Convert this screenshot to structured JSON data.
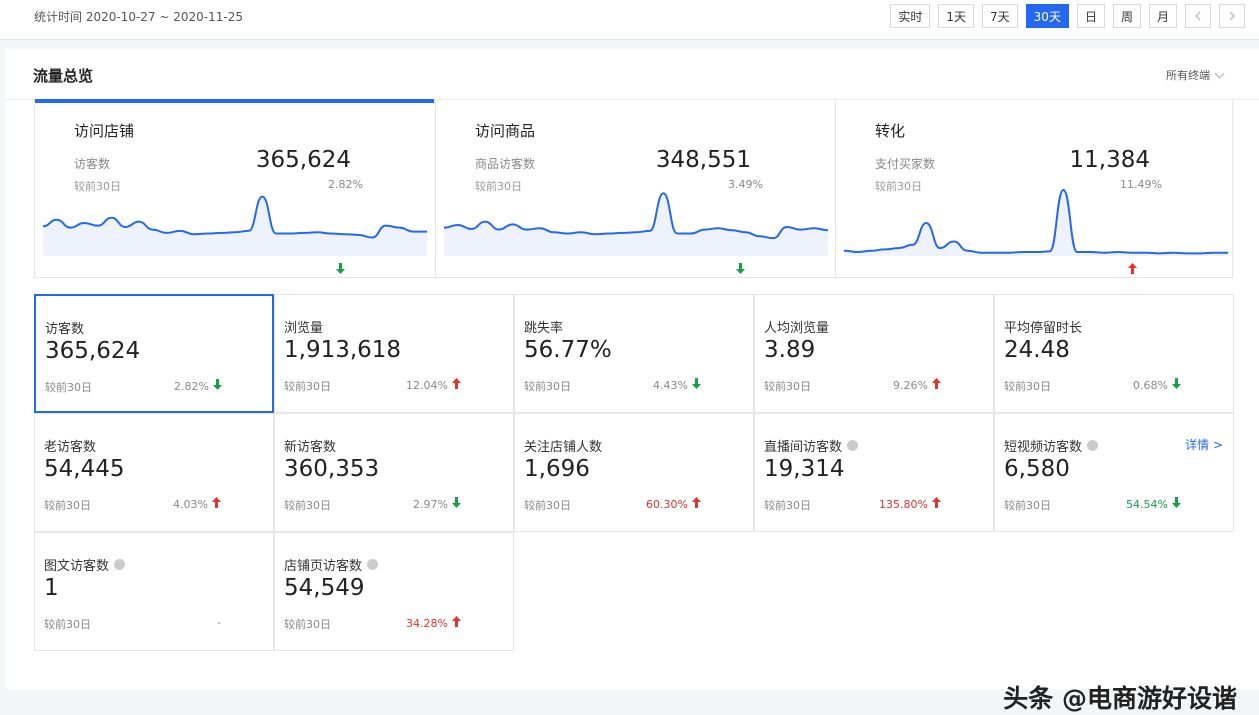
{
  "header": {
    "period": "统计时间 2020-10-27 ~ 2020-11-25",
    "ranges": [
      "实时",
      "1天",
      "7天",
      "30天",
      "日",
      "周",
      "月"
    ],
    "active_range": "30天"
  },
  "panel": {
    "title": "流量总览",
    "terminal_filter": "所有终端"
  },
  "cards": [
    {
      "title": "访问店铺",
      "label": "访客数",
      "value": "365,624",
      "compare": "较前30日",
      "pct": "2.82%",
      "trend": "down",
      "spark": [
        0.45,
        0.55,
        0.43,
        0.5,
        0.46,
        0.58,
        0.44,
        0.52,
        0.4,
        0.35,
        0.38,
        0.33,
        0.34,
        0.35,
        0.36,
        0.38,
        0.9,
        0.34,
        0.34,
        0.35,
        0.36,
        0.34,
        0.33,
        0.32,
        0.28,
        0.46,
        0.43,
        0.37,
        0.37
      ]
    },
    {
      "title": "访问商品",
      "label": "商品访客数",
      "value": "348,551",
      "compare": "较前30日",
      "pct": "3.49%",
      "trend": "down",
      "spark": [
        0.43,
        0.47,
        0.41,
        0.52,
        0.4,
        0.48,
        0.4,
        0.42,
        0.36,
        0.34,
        0.36,
        0.33,
        0.34,
        0.35,
        0.36,
        0.38,
        0.95,
        0.34,
        0.34,
        0.4,
        0.42,
        0.39,
        0.36,
        0.3,
        0.27,
        0.44,
        0.4,
        0.42,
        0.39
      ]
    },
    {
      "title": "转化",
      "label": "支付买家数",
      "value": "11,384",
      "compare": "较前30日",
      "pct": "11.49%",
      "trend": "up",
      "spark": [
        0.08,
        0.06,
        0.08,
        0.1,
        0.12,
        0.17,
        0.5,
        0.12,
        0.22,
        0.08,
        0.05,
        0.05,
        0.05,
        0.06,
        0.06,
        0.07,
        1.0,
        0.06,
        0.06,
        0.05,
        0.06,
        0.05,
        0.05,
        0.04,
        0.05,
        0.04,
        0.04,
        0.05,
        0.05
      ]
    }
  ],
  "metrics": [
    {
      "label": "访客数",
      "value": "365,624",
      "compare": "较前30日",
      "pct": "2.82%",
      "trend": "down",
      "selected": true,
      "info": false
    },
    {
      "label": "浏览量",
      "value": "1,913,618",
      "compare": "较前30日",
      "pct": "12.04%",
      "trend": "up",
      "info": false
    },
    {
      "label": "跳失率",
      "value": "56.77%",
      "compare": "较前30日",
      "pct": "4.43%",
      "trend": "down",
      "info": false
    },
    {
      "label": "人均浏览量",
      "value": "3.89",
      "compare": "较前30日",
      "pct": "9.26%",
      "trend": "up",
      "info": false
    },
    {
      "label": "平均停留时长",
      "value": "24.48",
      "compare": "较前30日",
      "pct": "0.68%",
      "trend": "down",
      "info": false
    },
    {
      "label": "老访客数",
      "value": "54,445",
      "compare": "较前30日",
      "pct": "4.03%",
      "trend": "up",
      "info": false
    },
    {
      "label": "新访客数",
      "value": "360,353",
      "compare": "较前30日",
      "pct": "2.97%",
      "trend": "down",
      "info": false
    },
    {
      "label": "关注店铺人数",
      "value": "1,696",
      "compare": "较前30日",
      "pct": "60.30%",
      "trend": "up",
      "color": "red",
      "info": false
    },
    {
      "label": "直播间访客数",
      "value": "19,314",
      "compare": "较前30日",
      "pct": "135.80%",
      "trend": "up",
      "color": "red",
      "info": true
    },
    {
      "label": "短视频访客数",
      "value": "6,580",
      "compare": "较前30日",
      "pct": "54.54%",
      "trend": "down",
      "color": "green",
      "info": true,
      "detail": "详情 >"
    },
    {
      "label": "图文访客数",
      "value": "1",
      "compare": "较前30日",
      "pct": "-",
      "trend": "none",
      "info": true
    },
    {
      "label": "店铺页访客数",
      "value": "54,549",
      "compare": "较前30日",
      "pct": "34.28%",
      "trend": "up",
      "color": "red",
      "info": true
    }
  ],
  "watermark": "头条 @电商游好设谐",
  "colors": {
    "accent": "#2468f2",
    "up": "#e5322d",
    "down": "#15a04a"
  }
}
